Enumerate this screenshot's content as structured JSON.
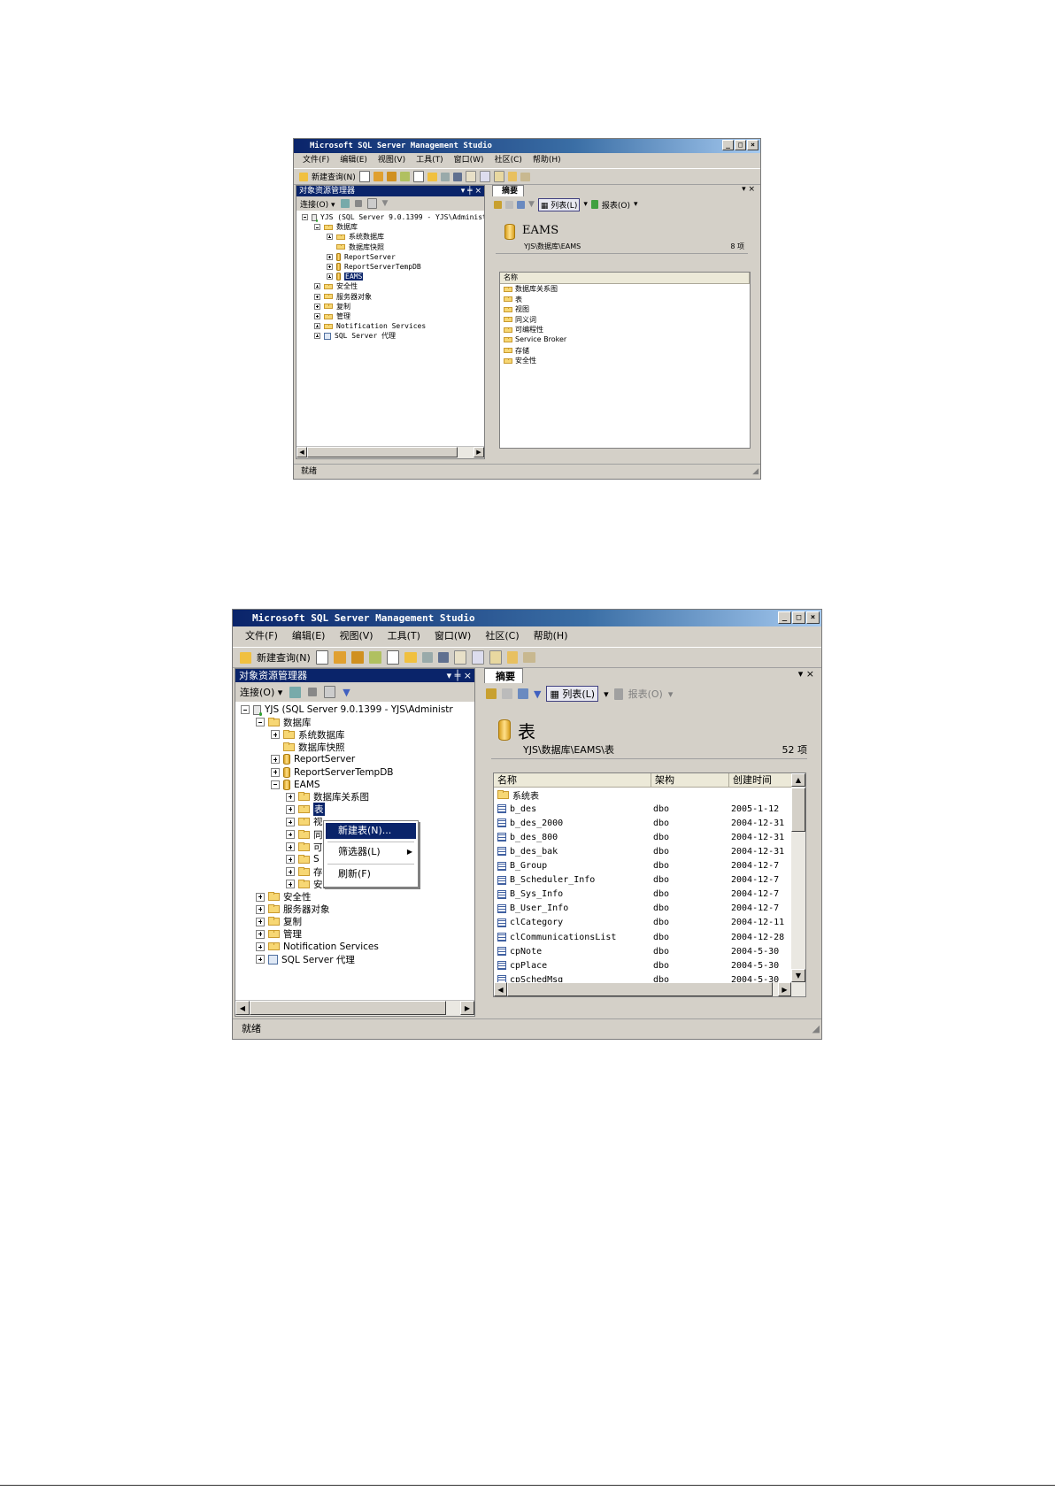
{
  "win1": {
    "title": "Microsoft SQL Server Management Studio",
    "menu": [
      "文件(F)",
      "编辑(E)",
      "视图(V)",
      "工具(T)",
      "窗口(W)",
      "社区(C)",
      "帮助(H)"
    ],
    "new_query": "新建查询(N)",
    "explorer_title": "对象资源管理器",
    "connect": "连接(O) ▾",
    "tree": [
      {
        "label": "YJS (SQL Server 9.0.1399 - YJS\\Administr",
        "icon": "server-icon",
        "exp": "minus"
      },
      {
        "label": "数据库",
        "icon": "folder-icon",
        "exp": "minus"
      },
      {
        "label": "系统数据库",
        "icon": "folder-icon",
        "exp": "plus"
      },
      {
        "label": "数据库快照",
        "icon": "folder-icon",
        "exp": "none"
      },
      {
        "label": "ReportServer",
        "icon": "database-icon",
        "exp": "plus"
      },
      {
        "label": "ReportServerTempDB",
        "icon": "database-icon",
        "exp": "plus"
      },
      {
        "label": "EAMS",
        "icon": "database-icon",
        "exp": "plus",
        "selected": true
      },
      {
        "label": "安全性",
        "icon": "folder-icon",
        "exp": "plus"
      },
      {
        "label": "服务器对象",
        "icon": "folder-icon",
        "exp": "plus"
      },
      {
        "label": "复制",
        "icon": "folder-icon",
        "exp": "plus"
      },
      {
        "label": "管理",
        "icon": "folder-icon",
        "exp": "plus"
      },
      {
        "label": "Notification Services",
        "icon": "folder-icon",
        "exp": "plus"
      },
      {
        "label": "SQL Server 代理",
        "icon": "agent-icon",
        "exp": "plus"
      }
    ],
    "summary_tab": "摘要",
    "list_btn": "列表(L)",
    "report_btn": "报表(O)",
    "db_name": "EAMS",
    "path": "YJS\\数据库\\EAMS",
    "count": "8 项",
    "col_name": "名称",
    "items": [
      "数据库关系图",
      "表",
      "视图",
      "同义词",
      "可编程性",
      "Service Broker",
      "存储",
      "安全性"
    ],
    "status": "就绪"
  },
  "win2": {
    "title": "Microsoft SQL Server Management Studio",
    "menu": [
      "文件(F)",
      "编辑(E)",
      "视图(V)",
      "工具(T)",
      "窗口(W)",
      "社区(C)",
      "帮助(H)"
    ],
    "new_query": "新建查询(N)",
    "explorer_title": "对象资源管理器",
    "connect": "连接(O) ▾",
    "tree": [
      {
        "label": "YJS (SQL Server 9.0.1399 - YJS\\Administr",
        "icon": "server-icon",
        "exp": "minus"
      },
      {
        "label": "数据库",
        "icon": "folder-icon",
        "exp": "minus"
      },
      {
        "label": "系统数据库",
        "icon": "folder-icon",
        "exp": "plus"
      },
      {
        "label": "数据库快照",
        "icon": "folder-icon",
        "exp": "none"
      },
      {
        "label": "ReportServer",
        "icon": "database-icon",
        "exp": "plus"
      },
      {
        "label": "ReportServerTempDB",
        "icon": "database-icon",
        "exp": "plus"
      },
      {
        "label": "EAMS",
        "icon": "database-icon",
        "exp": "minus"
      },
      {
        "label": "数据库关系图",
        "icon": "folder-icon",
        "exp": "plus"
      },
      {
        "label": "表",
        "icon": "folder-icon",
        "exp": "plus",
        "selected": true
      },
      {
        "label": "视",
        "icon": "folder-icon",
        "exp": "plus"
      },
      {
        "label": "同",
        "icon": "folder-icon",
        "exp": "plus"
      },
      {
        "label": "可",
        "icon": "folder-icon",
        "exp": "plus"
      },
      {
        "label": "S",
        "icon": "folder-icon",
        "exp": "plus"
      },
      {
        "label": "存储",
        "icon": "folder-icon",
        "exp": "plus"
      },
      {
        "label": "安全性",
        "icon": "folder-icon",
        "exp": "plus"
      },
      {
        "label": "安全性",
        "icon": "folder-icon",
        "exp": "plus"
      },
      {
        "label": "服务器对象",
        "icon": "folder-icon",
        "exp": "plus"
      },
      {
        "label": "复制",
        "icon": "folder-icon",
        "exp": "plus"
      },
      {
        "label": "管理",
        "icon": "folder-icon",
        "exp": "plus"
      },
      {
        "label": "Notification Services",
        "icon": "folder-icon",
        "exp": "plus"
      },
      {
        "label": "SQL Server 代理",
        "icon": "agent-icon",
        "exp": "plus"
      }
    ],
    "context_menu": [
      "新建表(N)...",
      "筛选器(L)",
      "刷新(F)"
    ],
    "summary_tab": "摘要",
    "list_btn": "列表(L)",
    "report_btn": "报表(O)",
    "folder_name": "表",
    "path": "YJS\\数据库\\EAMS\\表",
    "count": "52 项",
    "columns": [
      "名称",
      "架构",
      "创建时间"
    ],
    "rows": [
      {
        "name": "系统表",
        "schema": "",
        "date": "",
        "folder": true
      },
      {
        "name": "b_des",
        "schema": "dbo",
        "date": "2005-1-12"
      },
      {
        "name": "b_des_2000",
        "schema": "dbo",
        "date": "2004-12-31"
      },
      {
        "name": "b_des_800",
        "schema": "dbo",
        "date": "2004-12-31"
      },
      {
        "name": "b_des_bak",
        "schema": "dbo",
        "date": "2004-12-31"
      },
      {
        "name": "B_Group",
        "schema": "dbo",
        "date": "2004-12-7"
      },
      {
        "name": "B_Scheduler_Info",
        "schema": "dbo",
        "date": "2004-12-7"
      },
      {
        "name": "B_Sys_Info",
        "schema": "dbo",
        "date": "2004-12-7"
      },
      {
        "name": "B_User_Info",
        "schema": "dbo",
        "date": "2004-12-7"
      },
      {
        "name": "clCategory",
        "schema": "dbo",
        "date": "2004-12-11"
      },
      {
        "name": "clCommunicationsList",
        "schema": "dbo",
        "date": "2004-12-28"
      },
      {
        "name": "cpNote",
        "schema": "dbo",
        "date": "2004-5-30"
      },
      {
        "name": "cpPlace",
        "schema": "dbo",
        "date": "2004-5-30"
      },
      {
        "name": "cpSchedMsg",
        "schema": "dbo",
        "date": "2004-5-30"
      }
    ],
    "status": "就绪"
  }
}
